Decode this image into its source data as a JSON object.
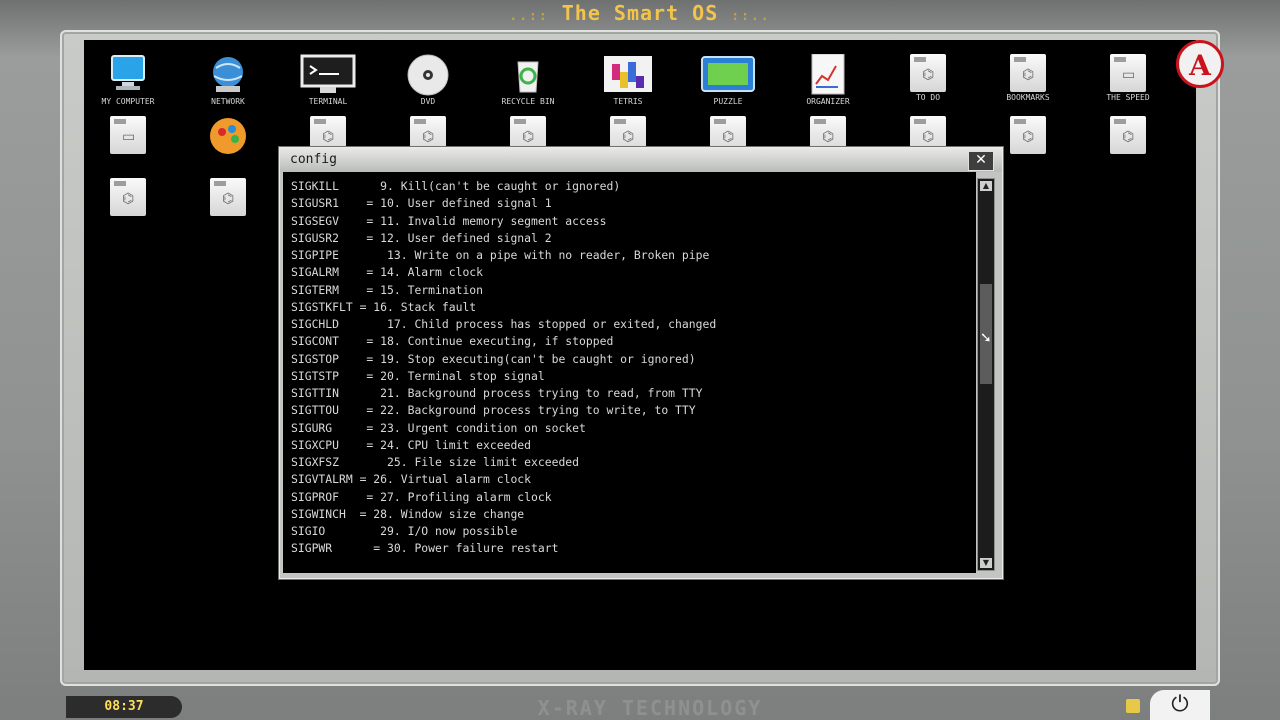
{
  "title": "The Smart OS",
  "title_deco_left": "..::",
  "title_deco_right": "::..",
  "desktop_icons": [
    {
      "label": "MY COMPUTER",
      "icon": "computer-icon"
    },
    {
      "label": "NETWORK",
      "icon": "network-icon"
    },
    {
      "label": "TERMINAL",
      "icon": "terminal-icon"
    },
    {
      "label": "DVD",
      "icon": "dvd-icon"
    },
    {
      "label": "RECYCLE BIN",
      "icon": "recycle-bin-icon"
    },
    {
      "label": "TETRIS",
      "icon": "tetris-icon"
    },
    {
      "label": "PUZZLE",
      "icon": "puzzle-icon"
    },
    {
      "label": "ORGANIZER",
      "icon": "chart-doc-icon"
    },
    {
      "label": "TO DO",
      "icon": "document-icon"
    },
    {
      "label": "BOOKMARKS",
      "icon": "document-icon"
    },
    {
      "label": "THE SPEED",
      "icon": "document-icon"
    }
  ],
  "window": {
    "title": "config",
    "close_glyph": "✕",
    "lines": [
      "SIGKILL      9. Kill(can't be caught or ignored)",
      "SIGUSR1    = 10. User defined signal 1",
      "SIGSEGV    = 11. Invalid memory segment access",
      "SIGUSR2    = 12. User defined signal 2",
      "SIGPIPE       13. Write on a pipe with no reader, Broken pipe",
      "SIGALRM    = 14. Alarm clock",
      "SIGTERM    = 15. Termination",
      "SIGSTKFLT = 16. Stack fault",
      "SIGCHLD       17. Child process has stopped or exited, changed",
      "SIGCONT    = 18. Continue executing, if stopped",
      "SIGSTOP    = 19. Stop executing(can't be caught or ignored)",
      "SIGTSTP    = 20. Terminal stop signal",
      "SIGTTIN      21. Background process trying to read, from TTY",
      "SIGTTOU    = 22. Background process trying to write, to TTY",
      "SIGURG     = 23. Urgent condition on socket",
      "SIGXCPU    = 24. CPU limit exceeded",
      "SIGXFSZ       25. File size limit exceeded",
      "SIGVTALRM = 26. Virtual alarm clock",
      "SIGPROF    = 27. Profiling alarm clock",
      "SIGWINCH  = 28. Window size change",
      "SIGIO        29. I/O now possible",
      "SIGPWR      = 30. Power failure restart"
    ]
  },
  "taskbar": {
    "clock": "08:37",
    "footer": "X-RAY TECHNOLOGY"
  },
  "logo_letter": "A"
}
